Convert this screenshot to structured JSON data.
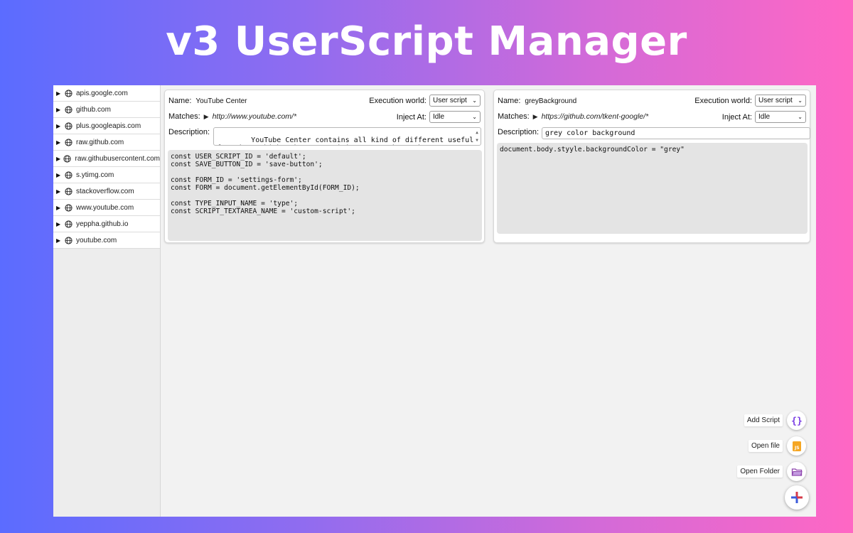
{
  "banner": {
    "title": "v3 UserScript Manager"
  },
  "sidebar": {
    "sites": [
      {
        "label": "apis.google.com"
      },
      {
        "label": "github.com"
      },
      {
        "label": "plus.googleapis.com"
      },
      {
        "label": "raw.github.com"
      },
      {
        "label": "raw.githubusercontent.com"
      },
      {
        "label": "s.ytimg.com"
      },
      {
        "label": "stackoverflow.com"
      },
      {
        "label": "www.youtube.com"
      },
      {
        "label": "yeppha.github.io"
      },
      {
        "label": "youtube.com"
      }
    ]
  },
  "scripts": [
    {
      "name_label": "Name:",
      "name": "YouTube Center",
      "execution_world_label": "Execution world:",
      "execution_world": "User script",
      "matches_label": "Matches:",
      "matches": "http://www.youtube.com/*",
      "inject_at_label": "Inject At:",
      "inject_at": "Idle",
      "description_label": "Description:",
      "description": "YouTube Center contains all kind of different useful\nfunctions which makes your visit on YouTube much more",
      "code": "const USER_SCRIPT_ID = 'default';\nconst SAVE_BUTTON_ID = 'save-button';\n\nconst FORM_ID = 'settings-form';\nconst FORM = document.getElementById(FORM_ID);\n\nconst TYPE_INPUT_NAME = 'type';\nconst SCRIPT_TEXTAREA_NAME = 'custom-script';"
    },
    {
      "name_label": "Name:",
      "name": "greyBackground",
      "execution_world_label": "Execution world:",
      "execution_world": "User script",
      "matches_label": "Matches:",
      "matches": "https://github.com/tkent-google/*",
      "inject_at_label": "Inject At:",
      "inject_at": "Idle",
      "description_label": "Description:",
      "description": "grey color background",
      "code": "document.body.styyle.backgroundColor = \"grey\""
    }
  ],
  "actions": {
    "add_script": "Add Script",
    "open_file": "Open file",
    "open_folder": "Open Folder"
  },
  "icons": {
    "add_script": "curly-braces-icon",
    "open_file": "js-file-icon",
    "open_folder": "folder-icon",
    "main": "plus-icon",
    "site": "globe-icon"
  },
  "colors": {
    "gradient_start": "#5b6cff",
    "gradient_end": "#ff67c4",
    "braces_purple": "#7b3fe4",
    "js_orange": "#f5a623",
    "folder_purple": "#8e44ad",
    "plus_red": "#d63a4a",
    "plus_blue": "#3b5bdb"
  }
}
